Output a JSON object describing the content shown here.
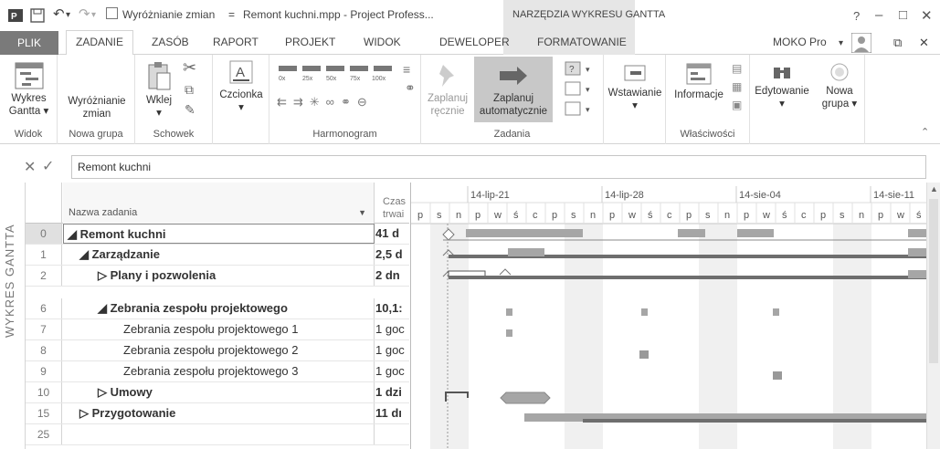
{
  "titlebar": {
    "track_changes": "Wyróżnianie zmian",
    "separator": "=",
    "doc_title": "Remont kuchni.mpp - Project Profess...",
    "context_tab": "NARZĘDZIA WYKRESU GANTTA",
    "help": "?",
    "minimize": "–",
    "restore": "□",
    "close": "✕"
  },
  "tabs": {
    "file": "PLIK",
    "items": [
      "ZADANIE",
      "ZASÓB",
      "RAPORT",
      "PROJEKT",
      "WIDOK",
      "DEWELOPER",
      "FORMATOWANIE"
    ],
    "user": "MOKO Pro"
  },
  "ribbon": {
    "view_btn_1": "Wykres",
    "view_btn_2": "Gantta",
    "view_group": "Widok",
    "highlight_btn_1": "Wyróżnianie",
    "highlight_btn_2": "zmian",
    "newgroup_group": "Nowa grupa",
    "paste_btn": "Wklej",
    "clipboard_group": "Schowek",
    "font_btn": "Czcionka",
    "schedule_group": "Harmonogram",
    "pct": [
      "0x",
      "25x",
      "50x",
      "75x",
      "100x"
    ],
    "manual_1": "Zaplanuj",
    "manual_2": "ręcznie",
    "auto_1": "Zaplanuj",
    "auto_2": "automatycznie",
    "tasks_group": "Zadania",
    "insert_btn": "Wstawianie",
    "info_btn": "Informacje",
    "props_group": "Właściwości",
    "edit_btn": "Edytowanie",
    "newgroup_1": "Nowa",
    "newgroup_2": "grupa"
  },
  "formula": {
    "value": "Remont kuchni"
  },
  "side_label": "WYKRES GANTTA",
  "grid": {
    "col_name": "Nazwa zadania",
    "col_dur_1": "Czas",
    "col_dur_2": "trwai",
    "rows": [
      {
        "id": "0",
        "name": "◢ Remont kuchni",
        "dur": "41 d",
        "bold": true,
        "indent": 4
      },
      {
        "id": "1",
        "name": "◢ Zarządzanie",
        "dur": "2,5 d",
        "bold": true,
        "indent": 18
      },
      {
        "id": "2",
        "name": "▷ Plany i pozwolenia",
        "dur": "2 dn",
        "bold": true,
        "indent": 38
      },
      {
        "id": "6",
        "name": "◢ Zebrania zespołu projektowego",
        "dur": "10,1:",
        "bold": true,
        "indent": 38
      },
      {
        "id": "7",
        "name": "Zebrania zespołu projektowego 1",
        "dur": "1 goc",
        "bold": false,
        "indent": 66
      },
      {
        "id": "8",
        "name": "Zebrania zespołu projektowego 2",
        "dur": "1 goc",
        "bold": false,
        "indent": 66
      },
      {
        "id": "9",
        "name": "Zebrania zespołu projektowego 3",
        "dur": "1 goc",
        "bold": false,
        "indent": 66
      },
      {
        "id": "10",
        "name": "▷ Umowy",
        "dur": "1 dzi",
        "bold": true,
        "indent": 38
      },
      {
        "id": "15",
        "name": "▷ Przygotowanie",
        "dur": "11 dı",
        "bold": true,
        "indent": 18
      },
      {
        "id": "25",
        "name": "",
        "dur": "",
        "bold": false,
        "indent": 4
      }
    ]
  },
  "timeline": {
    "weeks": [
      "14-lip-21",
      "14-lip-28",
      "14-sie-04",
      "14-sie-11"
    ],
    "days": [
      "p",
      "s",
      "n",
      "p",
      "w",
      "ś",
      "c",
      "p",
      "s",
      "n",
      "p",
      "w",
      "ś",
      "c",
      "p",
      "s",
      "n",
      "p",
      "w",
      "ś",
      "c",
      "p",
      "s",
      "n",
      "p",
      "w",
      "ś"
    ]
  },
  "colors": {
    "bar": "#a6a6a6",
    "summary": "#6e6e6e",
    "weekend": "#f0f0f0"
  }
}
